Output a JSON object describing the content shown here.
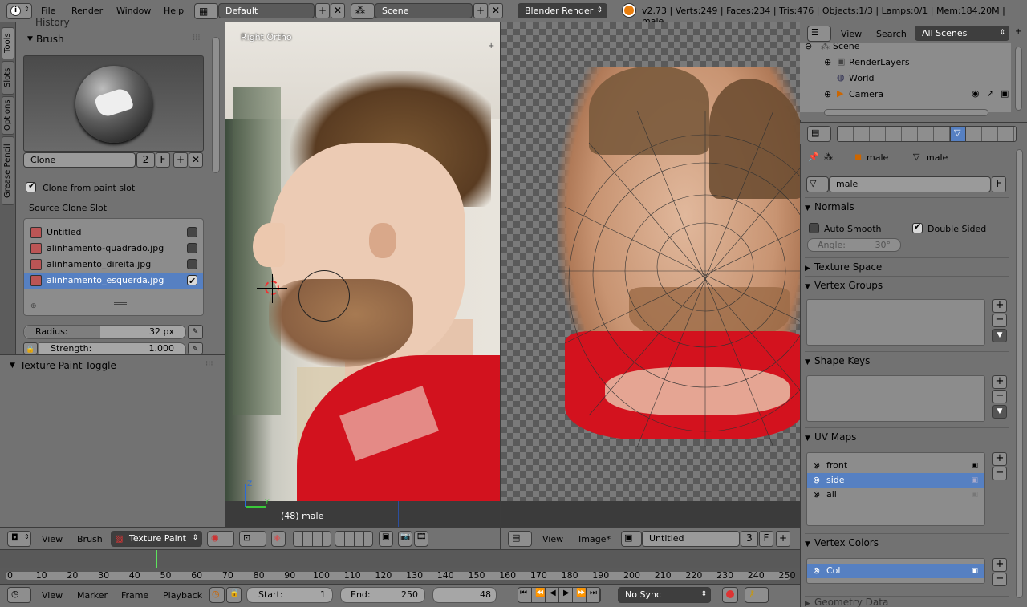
{
  "topbar": {
    "menus": [
      "File",
      "Render",
      "Window",
      "Help"
    ],
    "layout": "Default",
    "scene": "Scene",
    "engine": "Blender Render",
    "stats": "v2.73 | Verts:249 | Faces:234 | Tris:476 | Objects:1/3 | Lamps:0/1 | Mem:184.20M | male"
  },
  "tool_tabs": [
    "Tools",
    "Slots",
    "Options",
    "Grease Pencil"
  ],
  "brush_panel": {
    "title": "Brush",
    "clipped_header": "History",
    "brush_name": "Clone",
    "users": "2",
    "fake_user": "F",
    "clone_from_slot": "Clone from paint slot",
    "source_label": "Source Clone Slot",
    "slots": [
      "Untitled",
      "alinhamento-quadrado.jpg",
      "alinhamento_direita.jpg",
      "alinhamento_esquerda.jpg"
    ],
    "radius_label": "Radius:",
    "radius_value": "32 px",
    "strength_label": "Strength:",
    "strength_value": "1.000"
  },
  "toggle_panel": {
    "title": "Texture Paint Toggle"
  },
  "viewport": {
    "view_name": "Right Ortho",
    "object_label": "(48) male",
    "header": {
      "view": "View",
      "brush": "Brush",
      "mode": "Texture Paint"
    }
  },
  "image_editor": {
    "header": {
      "view": "View",
      "image": "Image*",
      "image_name": "Untitled",
      "users": "3",
      "fake": "F"
    }
  },
  "outliner": {
    "view": "View",
    "search": "Search",
    "filter": "All Scenes",
    "items": [
      "Scene",
      "RenderLayers",
      "World",
      "Camera"
    ]
  },
  "properties": {
    "breadcrumb_object": "male",
    "breadcrumb_mesh": "male",
    "mesh_name": "male",
    "fake": "F",
    "normals": {
      "title": "Normals",
      "auto_smooth": "Auto Smooth",
      "double_sided": "Double Sided",
      "angle_label": "Angle:",
      "angle_value": "30°"
    },
    "texture_space": "Texture Space",
    "vertex_groups": "Vertex Groups",
    "shape_keys": "Shape Keys",
    "uv_maps": {
      "title": "UV Maps",
      "items": [
        "front",
        "side",
        "all"
      ]
    },
    "vertex_colors": {
      "title": "Vertex Colors",
      "items": [
        "Col"
      ]
    },
    "geometry_data": "Geometry Data"
  },
  "timeline": {
    "ticks": [
      "0",
      "10",
      "20",
      "30",
      "40",
      "50",
      "60",
      "70",
      "80",
      "90",
      "100",
      "110",
      "120",
      "130",
      "140",
      "150",
      "160",
      "170",
      "180",
      "190",
      "200",
      "210",
      "220",
      "230",
      "240",
      "250"
    ],
    "bottom": {
      "view": "View",
      "marker": "Marker",
      "frame": "Frame",
      "playback": "Playback",
      "start_label": "Start:",
      "start_value": "1",
      "end_label": "End:",
      "end_value": "250",
      "current": "48",
      "sync": "No Sync"
    }
  },
  "colors": {
    "selected": "#5680c2",
    "panel": "#727272",
    "header": "#727272",
    "dark": "#393939"
  }
}
